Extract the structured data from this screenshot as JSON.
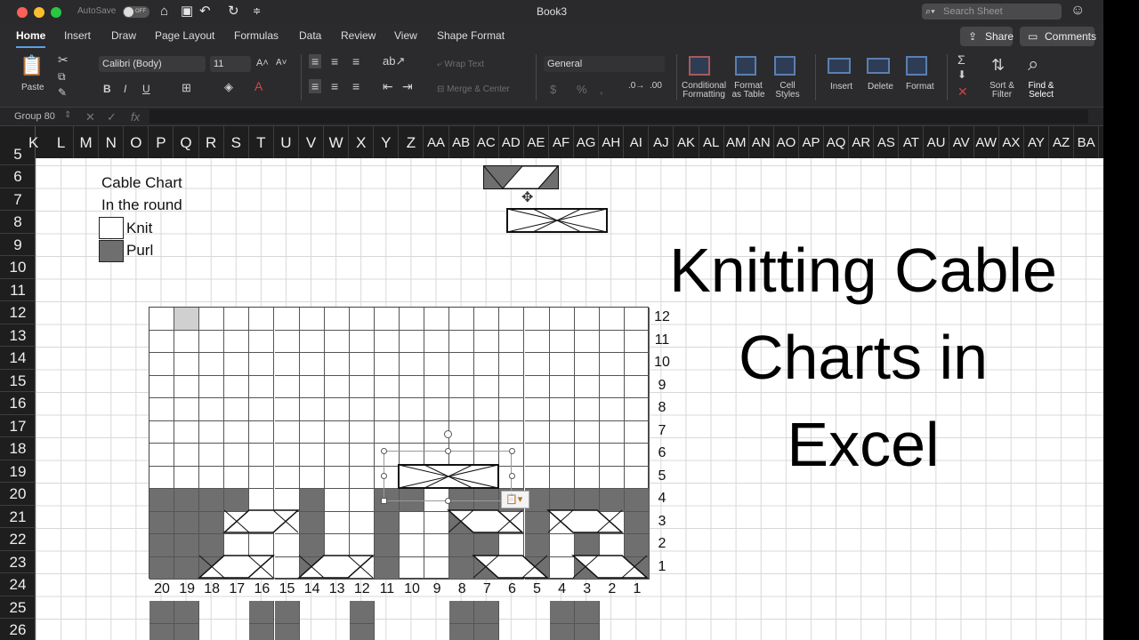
{
  "titlebar": {
    "autosave": "AutoSave",
    "autosave_state": "OFF",
    "title": "Book3",
    "search_placeholder": "Search Sheet"
  },
  "tabs": [
    "Home",
    "Insert",
    "Draw",
    "Page Layout",
    "Formulas",
    "Data",
    "Review",
    "View",
    "Shape Format"
  ],
  "ribbon_actions": {
    "share": "Share",
    "comments": "Comments"
  },
  "ribbon": {
    "paste": "Paste",
    "font_name": "Calibri (Body)",
    "font_size": "11",
    "bold": "B",
    "italic": "I",
    "underline": "U",
    "wrap_text": "Wrap Text",
    "merge_center": "Merge & Center",
    "number_format": "General",
    "currency": "$",
    "percent": "%",
    "conditional_formatting": [
      "Conditional",
      "Formatting"
    ],
    "format_as_table": [
      "Format",
      "as Table"
    ],
    "cell_styles": [
      "Cell",
      "Styles"
    ],
    "insert": "Insert",
    "delete": "Delete",
    "format": "Format",
    "sort_filter": [
      "Sort &",
      "Filter"
    ],
    "find_select": [
      "Find &",
      "Select"
    ]
  },
  "formula_bar": {
    "name_box": "Group 80",
    "fx": "fx"
  },
  "columns": [
    "L",
    "M",
    "N",
    "O",
    "P",
    "Q",
    "R",
    "S",
    "T",
    "U",
    "V",
    "W",
    "X",
    "Y",
    "Z",
    "AA",
    "AB",
    "AC",
    "AD",
    "AE",
    "AF",
    "AG",
    "AH",
    "AI",
    "AJ",
    "AK",
    "AL",
    "AM",
    "AN",
    "AO",
    "AP",
    "AQ",
    "AR",
    "AS",
    "AT",
    "AU",
    "AV",
    "AW",
    "AX",
    "AY",
    "AZ",
    "BA"
  ],
  "rows": [
    "5",
    "6",
    "7",
    "8",
    "9",
    "10",
    "11",
    "12",
    "13",
    "14",
    "15",
    "16",
    "17",
    "18",
    "19",
    "20",
    "21",
    "22",
    "23",
    "24",
    "25",
    "26"
  ],
  "legend": {
    "title": "Cable Chart",
    "subtitle": "In the round",
    "knit": "Knit",
    "purl": "Purl"
  },
  "chart": {
    "row_numbers": [
      "12",
      "11",
      "10",
      "9",
      "8",
      "7",
      "6",
      "5",
      "4",
      "3",
      "2",
      "1"
    ],
    "stitch_numbers": [
      "20",
      "19",
      "18",
      "17",
      "16",
      "15",
      "14",
      "13",
      "12",
      "11",
      "10",
      "9",
      "8",
      "7",
      "6",
      "5",
      "4",
      "3",
      "2",
      "1"
    ],
    "colors": {
      "purl": "#6f6f6f",
      "knit": "#ffffff"
    }
  },
  "heading": [
    "Knitting Cable",
    "Charts in",
    "Excel"
  ]
}
